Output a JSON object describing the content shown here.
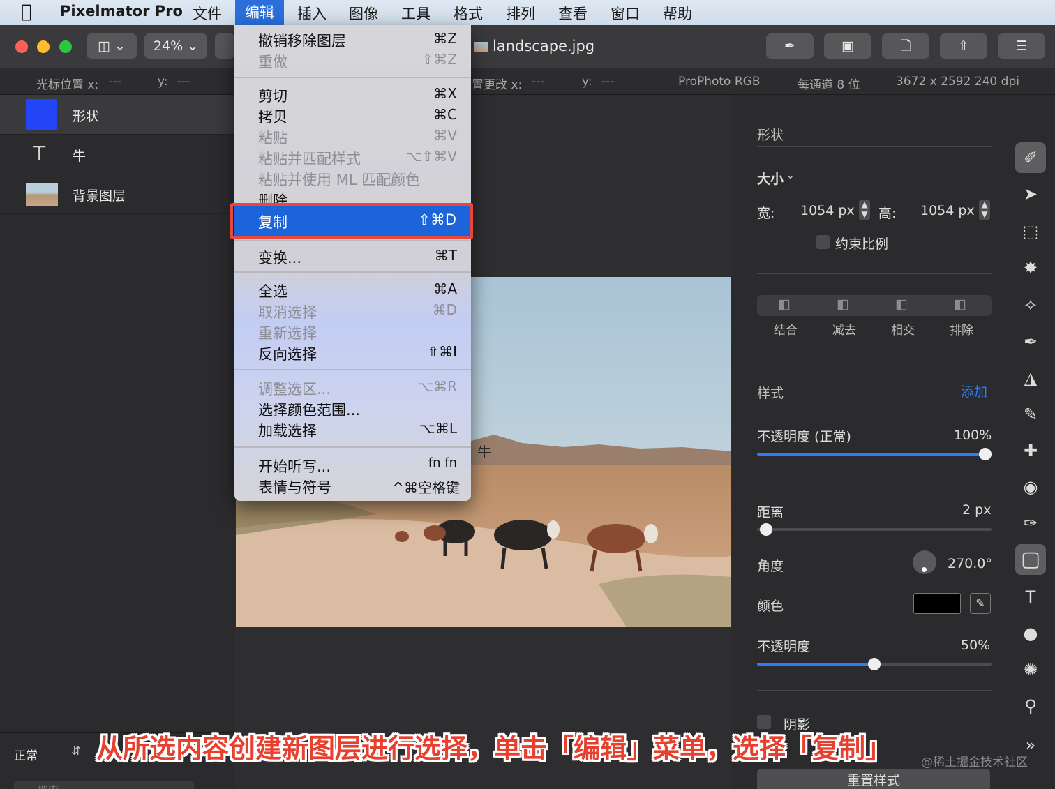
{
  "menubar": {
    "app_name": "Pixelmator Pro",
    "items": [
      "文件",
      "编辑",
      "插入",
      "图像",
      "工具",
      "格式",
      "排列",
      "查看",
      "窗口",
      "帮助"
    ]
  },
  "toolbar": {
    "zoom": "24%",
    "document_title": "landscape.jpg"
  },
  "infobar": {
    "cursor_x_label": "光标位置 x:",
    "cursor_x": "---",
    "cursor_y_label": "y:",
    "cursor_y": "---",
    "canvas_x_label": "置更改 x:",
    "canvas_x": "---",
    "canvas_y_label": "y:",
    "canvas_y": "---",
    "color_profile": "ProPhoto RGB",
    "bit_depth": "每通道 8 位",
    "dimensions": "3672 x 2592 240 dpi"
  },
  "layers": [
    {
      "name": "形状",
      "type": "shape",
      "color": "#2245f5"
    },
    {
      "name": "牛",
      "type": "text"
    },
    {
      "name": "背景图层",
      "type": "image"
    }
  ],
  "blend": {
    "mode": "正常",
    "search_placeholder": "搜索"
  },
  "canvas": {
    "text_layer": "牛"
  },
  "edit_menu": {
    "items": [
      {
        "label": "撤销移除图层",
        "shortcut": "⌘Z",
        "enabled": true
      },
      {
        "label": "重做",
        "shortcut": "⇧⌘Z",
        "enabled": false
      },
      {
        "label": "剪切",
        "shortcut": "⌘X",
        "enabled": true
      },
      {
        "label": "拷贝",
        "shortcut": "⌘C",
        "enabled": true
      },
      {
        "label": "粘贴",
        "shortcut": "⌘V",
        "enabled": false
      },
      {
        "label": "粘贴并匹配样式",
        "shortcut": "⌥⇧⌘V",
        "enabled": false
      },
      {
        "label": "粘贴并使用 ML 匹配颜色",
        "shortcut": "",
        "enabled": false
      },
      {
        "label": "删除",
        "shortcut": "",
        "enabled": true
      },
      {
        "label": "复制",
        "shortcut": "⇧⌘D",
        "enabled": true,
        "highlighted": true
      },
      {
        "label": "变换...",
        "shortcut": "⌘T",
        "enabled": true
      },
      {
        "label": "全选",
        "shortcut": "⌘A",
        "enabled": true
      },
      {
        "label": "取消选择",
        "shortcut": "⌘D",
        "enabled": false
      },
      {
        "label": "重新选择",
        "shortcut": "",
        "enabled": false
      },
      {
        "label": "反向选择",
        "shortcut": "⇧⌘I",
        "enabled": true
      },
      {
        "label": "调整选区...",
        "shortcut": "⌥⌘R",
        "enabled": false
      },
      {
        "label": "选择颜色范围...",
        "shortcut": "",
        "enabled": true
      },
      {
        "label": "加载选择",
        "shortcut": "⌥⌘L",
        "enabled": true
      },
      {
        "label": "开始听写...",
        "shortcut": "fn fn",
        "enabled": true
      },
      {
        "label": "表情与符号",
        "shortcut": "^⌘空格键",
        "enabled": true
      }
    ]
  },
  "inspector": {
    "section_title": "形状",
    "size_label": "大小",
    "width_label": "宽:",
    "width_value": "1054 px",
    "height_label": "高:",
    "height_value": "1054 px",
    "constrain_label": "约束比例",
    "bool_ops": [
      "结合",
      "减去",
      "相交",
      "排除"
    ],
    "style_label": "样式",
    "add_label": "添加",
    "opacity_mode_label": "不透明度 (正常)",
    "opacity_value": "100%",
    "opacity_fraction": 1.0,
    "distance_label": "距离",
    "distance_value": "2 px",
    "angle_label": "角度",
    "angle_value": "270.0°",
    "color_label": "颜色",
    "shadow_color": "#000000",
    "shadow_opacity_label": "不透明度",
    "shadow_opacity_value": "50%",
    "shadow_opacity_fraction": 0.5,
    "shadow_label": "阴影",
    "reset_label": "重置样式"
  },
  "tools": [
    "style-tool-icon",
    "arrange-icon",
    "rect-select-icon",
    "lasso-icon",
    "color-adjust-icon",
    "paint-icon",
    "fill-icon",
    "retouch-icon",
    "repair-icon",
    "distort-icon",
    "pen-icon",
    "shape-icon",
    "type-icon",
    "color-fill-icon",
    "effects-icon",
    "zoom-icon"
  ],
  "caption": "从所选内容创建新图层进行选择，单击「编辑」菜单，选择「复制」",
  "watermark": "@稀土掘金技术社区"
}
